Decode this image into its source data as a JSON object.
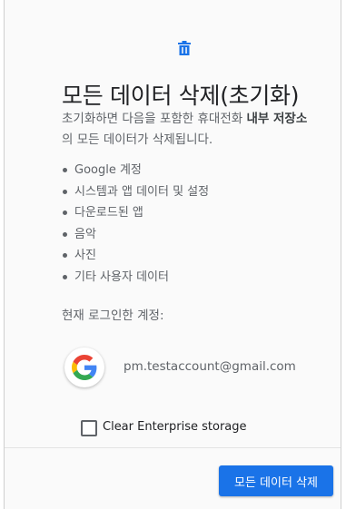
{
  "dialog": {
    "icon": "trash-icon",
    "title": "모든 데이터 삭제(초기화)",
    "description_prefix": "초기화하면 다음을 포함한 휴대전화 ",
    "description_bold": "내부 저장소",
    "description_suffix": "의 모든 데이터가 삭제됩니다.",
    "items": [
      "Google 계정",
      "시스템과 앱 데이터 및 설정",
      "다운로드된 앱",
      "음악",
      "사진",
      "기타 사용자 데이터"
    ],
    "account_label": "현재 로그인한 계정:",
    "account_icon": "google-icon",
    "account_email": "pm.testaccount@gmail.com",
    "checkbox_label": "Clear Enterprise storage",
    "checkbox_checked": false,
    "primary_button": "모든 데이터 삭제",
    "colors": {
      "accent": "#1a73e8",
      "google_blue": "#4285f4",
      "google_red": "#ea4335",
      "google_yellow": "#fbbc05",
      "google_green": "#34a853"
    }
  }
}
